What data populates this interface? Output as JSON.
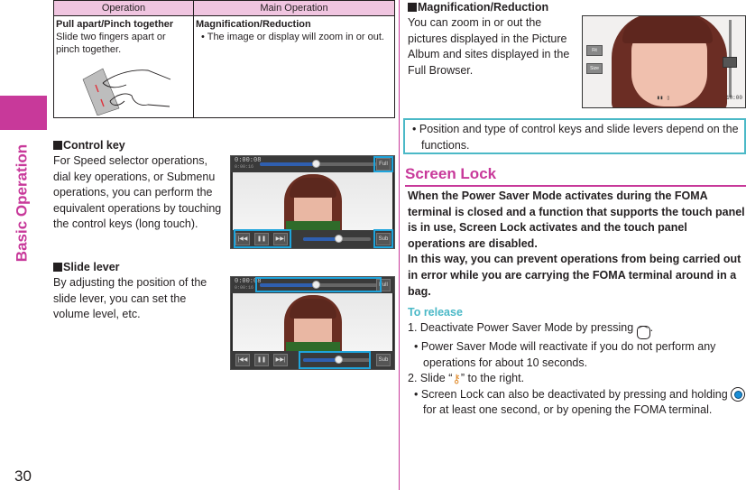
{
  "side_tab": {
    "label": "Basic Operation",
    "color": "#c8399a"
  },
  "page_number": "30",
  "table": {
    "headers": [
      "Operation",
      "Main Operation"
    ],
    "rows": [
      {
        "operation_title": "Pull apart/Pinch together",
        "operation_desc": "Slide two fingers apart or pinch together.",
        "main_title": "Magnification/Reduction",
        "main_bullet": "The image or display will zoom in or out."
      }
    ]
  },
  "control_key": {
    "title": "Control key",
    "body": "For Speed selector operations, dial key operations, or Submenu operations, you can perform the equivalent operations by touching the control keys (long touch)."
  },
  "slide_lever": {
    "title": "Slide lever",
    "body": "By adjusting the position of the slide lever, you can set the volume level, etc."
  },
  "player_screen": {
    "elapsed": "0:00:08",
    "total": "0:00:16",
    "playback_progress": 0.48,
    "volume_level": 0.52,
    "buttons": [
      "prev",
      "pause",
      "next"
    ],
    "top_right_button": "Full",
    "bottom_right_button": "Sub"
  },
  "magnification": {
    "title": "Magnification/Reduction",
    "body": "You can zoom in or out the pictures displayed in the Picture Album and sites displayed in the Full Browser."
  },
  "zoom_screen": {
    "button_1": "Fit",
    "button_2": "Size",
    "clock": "10:00",
    "zoom_level": 0.45
  },
  "note": "Position and type of control keys and slide levers depend on the functions.",
  "screen_lock": {
    "heading": "Screen Lock",
    "intro_1": "When the Power Saver Mode activates during the FOMA terminal is closed and a function that supports the touch panel is in use, Screen Lock activates and the touch panel operations are disabled.",
    "intro_2": "In this way, you can prevent operations from being carried out in error while you are carrying the FOMA terminal around in a bag.",
    "release_heading": "To release",
    "step1_num": "1.",
    "step1_text": "Deactivate Power Saver Mode by pressing",
    "step1_end": ".",
    "step1_note": "Power Saver Mode will reactivate if you do not perform any operations for about 10 seconds.",
    "step2_num": "2.",
    "step2_pre": "Slide “",
    "step2_post": "” to the right.",
    "step2_note_pre": "Screen Lock can also be deactivated by pressing and holding",
    "step2_note_post": "for at least one second, or by opening the FOMA terminal."
  },
  "colors": {
    "accent": "#c8399a",
    "cyan": "#4bb9c7",
    "highlight": "#1ea4dc",
    "table_header": "#f0c5e0"
  }
}
